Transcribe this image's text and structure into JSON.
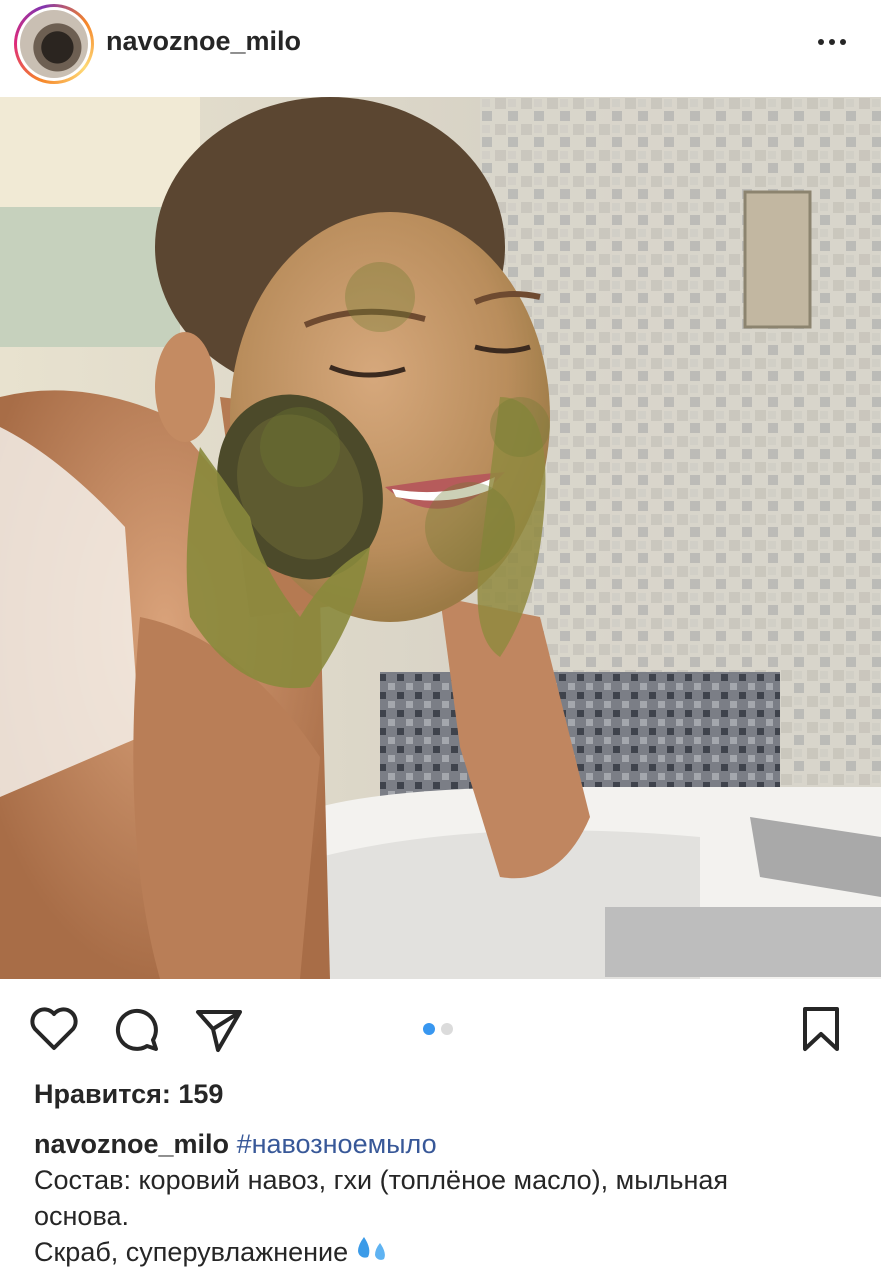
{
  "post": {
    "username": "navoznoe_milo",
    "image_alt": "woman washing face with green soap"
  },
  "actions": {
    "like": "heart-icon",
    "comment": "comment-icon",
    "share": "share-icon",
    "save": "bookmark-icon"
  },
  "carousel": {
    "total": 2,
    "active": 1
  },
  "likes_text": "Нравится: 159",
  "caption": {
    "username": "navoznoe_milo",
    "hashtag": "#навозноемыло",
    "line1": "Состав: коровий навоз, гхи (топлёное масло), мыльная",
    "line2": "основа.",
    "line3": "Скраб, суперувлажнение"
  },
  "colors": {
    "text": "#262626",
    "hashtag": "#385898",
    "dot_active": "#3897f0",
    "dot_inactive": "#dbdbdb"
  }
}
